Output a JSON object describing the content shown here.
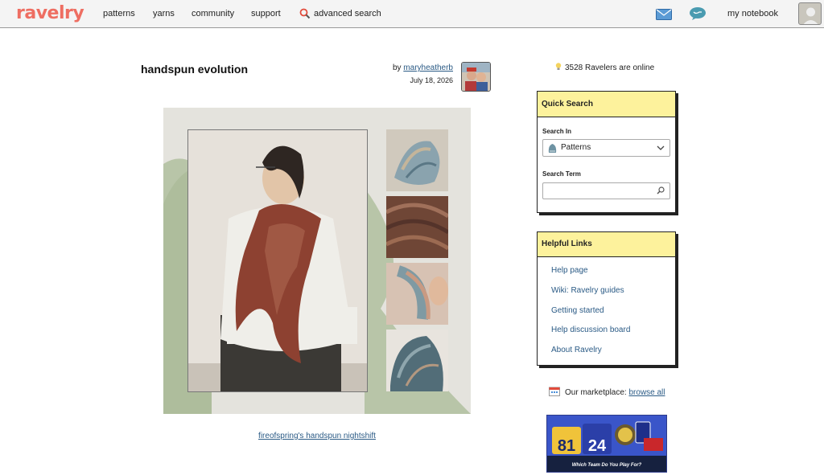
{
  "brand": "ravelry",
  "nav": {
    "patterns": "patterns",
    "yarns": "yarns",
    "community": "community",
    "support": "support",
    "advanced_search": "advanced search",
    "notebook": "my notebook",
    "icons": [
      "search-icon",
      "mail-icon",
      "chat-icon",
      "user-avatar"
    ]
  },
  "post": {
    "title": "handspun evolution",
    "by": "by",
    "author": "maryheatherb",
    "date": "July 18, 2026",
    "caption": "fireofspring's handspun nightshift"
  },
  "sidebar": {
    "online": "3528 Ravelers are online",
    "quick_search": {
      "heading": "Quick Search",
      "search_in_label": "Search In",
      "search_in_value": "Patterns",
      "search_term_label": "Search Term",
      "search_term_value": ""
    },
    "helpful_links": {
      "heading": "Helpful Links",
      "items": [
        "Help page",
        "Wiki: Ravelry guides",
        "Getting started",
        "Help discussion board",
        "About Ravelry"
      ]
    },
    "marketplace": {
      "label": "Our marketplace:",
      "link": "browse all"
    },
    "ad": {
      "numbers": [
        "81",
        "24"
      ],
      "tagline": "Which Team Do You Play For?"
    }
  },
  "colors": {
    "brand": "#ee6e62",
    "link": "#2a5a85",
    "box_header": "#fdf29c",
    "ad_bg": "#3a55c9"
  }
}
